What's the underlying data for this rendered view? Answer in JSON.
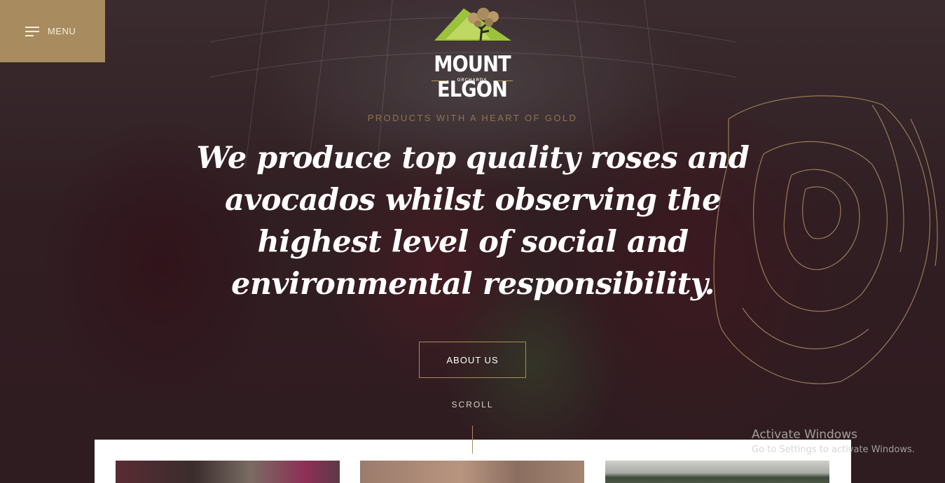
{
  "colors": {
    "accent_gold": "#a88c5f",
    "tagline_gold": "#8e7451",
    "headline_white": "#ffffff",
    "logo_green": "#9cc23c"
  },
  "menu": {
    "label": "MENU",
    "icon": "hamburger-menu-icon"
  },
  "logo": {
    "title": "MOUNT ELGON",
    "subtitle": "ORCHARDS",
    "icon": "mountain-tree-logo"
  },
  "hero": {
    "tagline": "PRODUCTS WITH A HEART OF GOLD",
    "headline": "We produce top quality roses and avocados whilst observing the highest level of social and environmental responsibility.",
    "cta_label": "ABOUT US",
    "scroll_label": "SCROLL"
  },
  "os_watermark": {
    "title": "Activate Windows",
    "subtitle": "Go to Settings to activate Windows."
  }
}
